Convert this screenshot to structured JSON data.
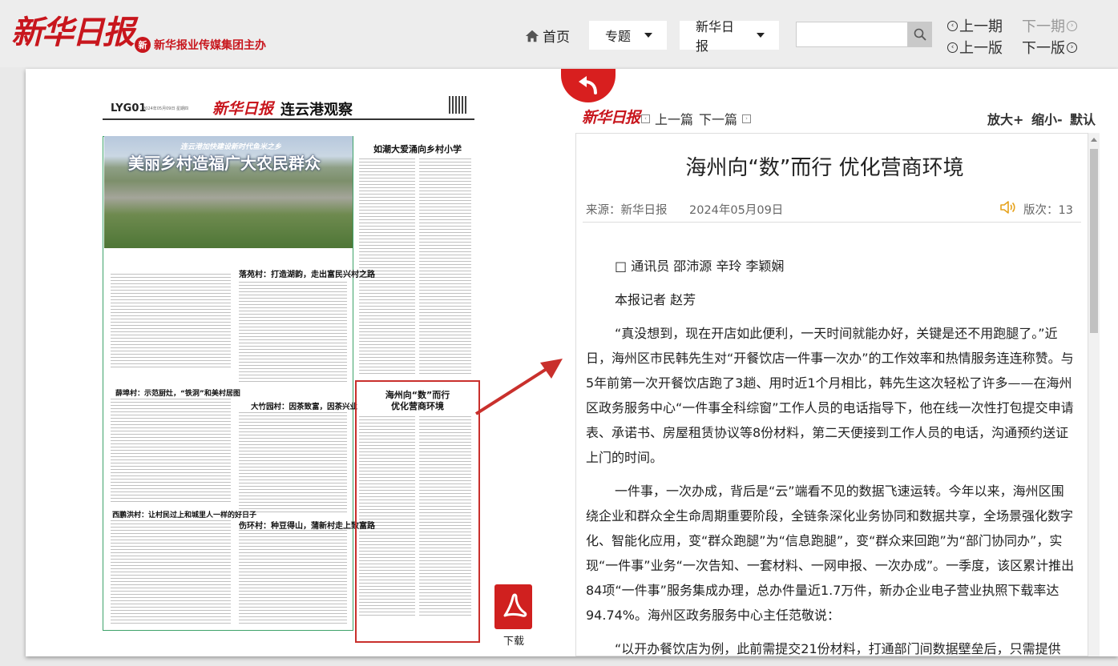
{
  "header": {
    "logo": "新华日报",
    "host_text": "新华报业传媒集团主办",
    "nav_home": "首页",
    "dropdown_topic": "专题",
    "dropdown_paper": "新华日报",
    "search_placeholder": "",
    "prev_issue": "上一期",
    "next_issue": "下一期",
    "prev_page": "上一版",
    "next_page": "下一版"
  },
  "newspaper": {
    "page_no": "LYG01",
    "date_line": "2024年05月09日 星期四",
    "masthead": "新华日报",
    "column": "连云港观察",
    "hero_subtitle": "连云港加快建设新时代鱼米之乡",
    "hero_title": "美丽乡村造福广大农民群众",
    "right_title": "如潮大爱涌向乡村小学",
    "selected_title_1": "海州向“数”而行",
    "selected_title_2": "优化营商环境",
    "sub1": "落苑村：打造湖韵，走出富民兴村之路",
    "sub2": "薛埠村：示范厨灶，“铁洞”和美村居图",
    "sub3": "大竹园村：因茶致富，因茶兴业",
    "sub4": "西鹏洪村：让村民过上和城里人一样的好日子",
    "sub5": "伤环村：种豆得山，蒲新村走上致富路"
  },
  "download_label": "下载",
  "article": {
    "toolbar_logo": "新华日报",
    "prev_article": "上一篇",
    "next_article": "下一篇",
    "zoom_in": "放大+",
    "zoom_out": "缩小-",
    "zoom_default": "默认",
    "title": "海州向“数”而行 优化营商环境",
    "source": "来源：新华日报",
    "date": "2024年05月09日",
    "edition": "版次：13",
    "byline1": "□ 通讯员 邵沛源 辛玲 李颖娴",
    "byline2": "本报记者 赵芳",
    "para1": "“真没想到，现在开店如此便利，一天时间就能办好，关键是还不用跑腿了。”近日，海州区市民韩先生对“开餐饮店一件事一次办”的工作效率和热情服务连连称赞。与5年前第一次开餐饮店跑了3趟、用时近1个月相比，韩先生这次轻松了许多——在海州区政务服务中心“一件事全科综窗”工作人员的电话指导下，他在线一次性打包提交申请表、承诺书、房屋租赁协议等8份材料，第二天便接到工作人员的电话，沟通预约送证上门的时间。",
    "para2": "一件事，一次办成，背后是“云”端看不见的数据飞速运转。今年以来，海州区围绕企业和群众全生命周期重要阶段，全链条深化业务协同和数据共享，全场景强化数字化、智能化应用，变“群众跑腿”为“信息跑腿”，变“群众来回跑”为“部门协同办”，实现“一件事”业务“一次告知、一套材料、一网申报、一次办成”。一季度，该区累计推出84项“一件事”服务集成办理，总办件量近1.7万件，新办企业电子营业执照下载率达94.74%。海州区政务服务中心主任范敬说：",
    "para3": "“以开办餐饮店为例，此前需提交21份材料，打通部门间数据壁垒后，只需提供"
  },
  "colors": {
    "brand_red": "#c8161d",
    "green_border": "#3ea36a"
  }
}
